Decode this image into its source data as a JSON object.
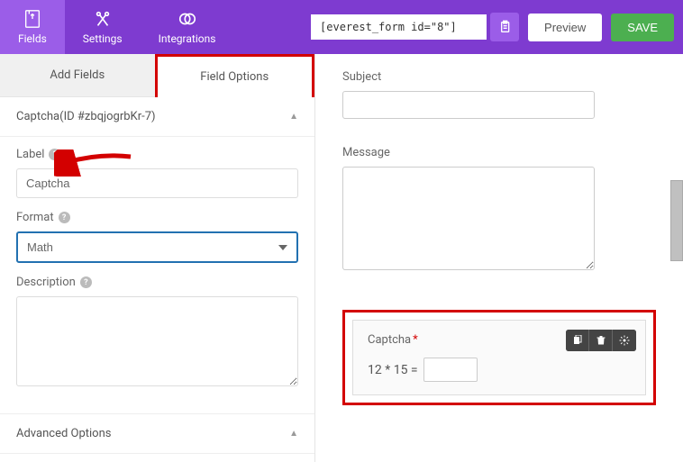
{
  "topbar": {
    "fields_label": "Fields",
    "settings_label": "Settings",
    "integrations_label": "Integrations",
    "shortcode": "[everest_form id=\"8\"]",
    "preview_label": "Preview",
    "save_label": "SAVE"
  },
  "sidebar": {
    "tab_add_fields": "Add Fields",
    "tab_field_options": "Field Options",
    "section_title": "Captcha(ID #zbqjogrbKr-7)",
    "label_text": "Label",
    "label_value": "Captcha",
    "format_text": "Format",
    "format_value": "Math",
    "description_text": "Description",
    "description_value": "",
    "advanced_options": "Advanced Options"
  },
  "canvas": {
    "subject_label": "Subject",
    "message_label": "Message",
    "captcha_label": "Captcha",
    "captcha_question": "12 * 15 ="
  }
}
